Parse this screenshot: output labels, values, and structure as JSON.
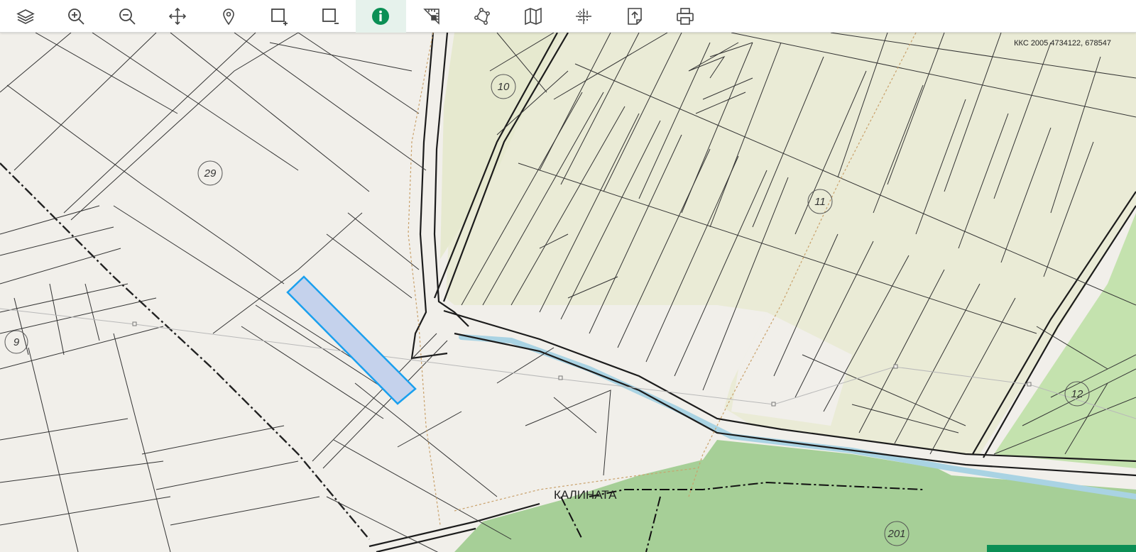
{
  "toolbar": {
    "tools": [
      {
        "name": "layers-icon"
      },
      {
        "name": "zoom-in-icon"
      },
      {
        "name": "zoom-out-icon"
      },
      {
        "name": "pan-icon"
      },
      {
        "name": "location-pin-icon"
      },
      {
        "name": "select-add-icon"
      },
      {
        "name": "select-remove-icon"
      },
      {
        "name": "info-icon",
        "active": true
      },
      {
        "name": "measure-icon"
      },
      {
        "name": "polygon-draw-icon"
      },
      {
        "name": "map-icon"
      },
      {
        "name": "crosshair-grid-icon"
      },
      {
        "name": "export-icon"
      },
      {
        "name": "print-icon"
      }
    ],
    "accent_color": "#0b8f55"
  },
  "map": {
    "coordinates": "ККС 2005 4734122, 678547",
    "parcel_labels": [
      "10",
      "29",
      "11",
      "9",
      "12",
      "201"
    ],
    "place_name": "КАЛИНАТА",
    "colors": {
      "background": "#f1efea",
      "agri_zone": "#eaebd6",
      "forest": "#a6cf97",
      "light_green": "#c4e2ae",
      "selected_parcel": "#c5d2ec",
      "selected_outline": "#1aa0ee",
      "canal": "#a9d3e3"
    }
  }
}
